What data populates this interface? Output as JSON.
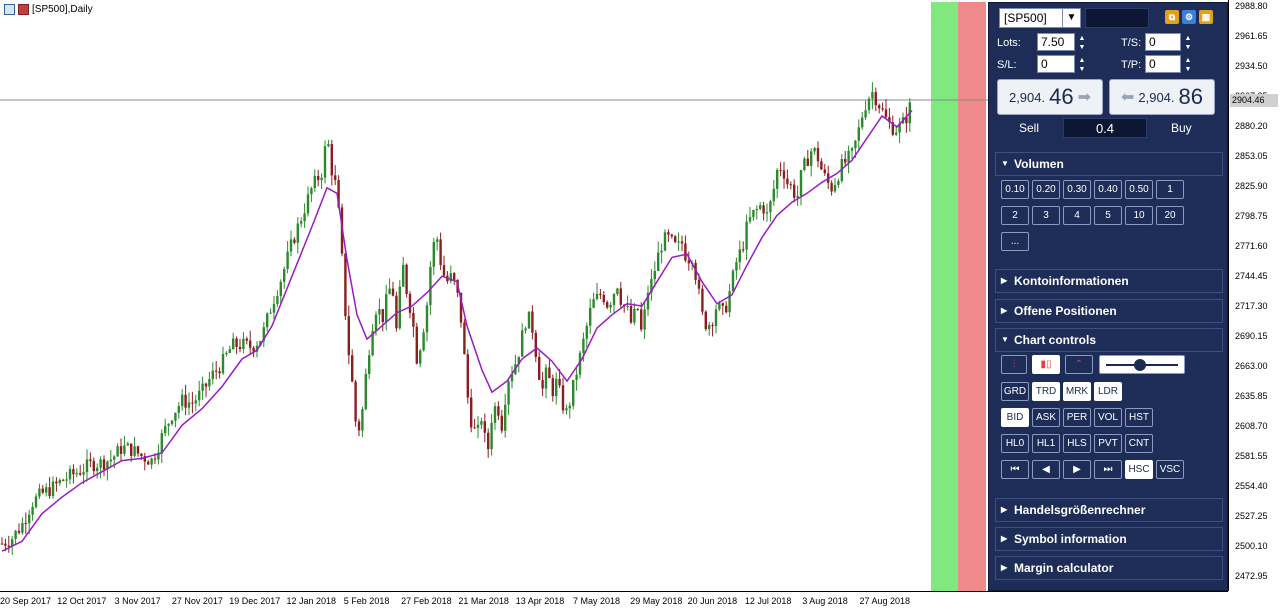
{
  "window": {
    "title": "[SP500],Daily"
  },
  "chart_data": {
    "type": "candlestick",
    "symbol": "[SP500]",
    "timeframe": "Daily",
    "ylim": [
      2460,
      2995
    ],
    "current_price": "2904.46",
    "price_ticks": [
      "2988.80",
      "2961.65",
      "2934.50",
      "2907.35",
      "2880.20",
      "2853.05",
      "2825.90",
      "2798.75",
      "2771.60",
      "2744.45",
      "2717.30",
      "2690.15",
      "2663.00",
      "2635.85",
      "2608.70",
      "2581.55",
      "2554.40",
      "2527.25",
      "2500.10",
      "2472.95"
    ],
    "time_ticks": [
      "20 Sep 2017",
      "12 Oct 2017",
      "3 Nov 2017",
      "27 Nov 2017",
      "19 Dec 2017",
      "12 Jan 2018",
      "5 Feb 2018",
      "27 Feb 2018",
      "21 Mar 2018",
      "13 Apr 2018",
      "7 May 2018",
      "29 May 2018",
      "20 Jun 2018",
      "12 Jul 2018",
      "3 Aug 2018",
      "27 Aug 2018"
    ],
    "close_path": [
      [
        0,
        2503
      ],
      [
        10,
        2508
      ],
      [
        20,
        2520
      ],
      [
        30,
        2540
      ],
      [
        40,
        2548
      ],
      [
        50,
        2553
      ],
      [
        60,
        2560
      ],
      [
        70,
        2565
      ],
      [
        80,
        2570
      ],
      [
        90,
        2575
      ],
      [
        100,
        2576
      ],
      [
        110,
        2580
      ],
      [
        120,
        2590
      ],
      [
        130,
        2588
      ],
      [
        140,
        2582
      ],
      [
        150,
        2578
      ],
      [
        160,
        2600
      ],
      [
        170,
        2620
      ],
      [
        180,
        2632
      ],
      [
        190,
        2630
      ],
      [
        200,
        2640
      ],
      [
        210,
        2655
      ],
      [
        220,
        2666
      ],
      [
        230,
        2682
      ],
      [
        240,
        2683
      ],
      [
        250,
        2681
      ],
      [
        260,
        2690
      ],
      [
        270,
        2720
      ],
      [
        280,
        2745
      ],
      [
        290,
        2775
      ],
      [
        300,
        2800
      ],
      [
        310,
        2825
      ],
      [
        320,
        2840
      ],
      [
        325,
        2872
      ],
      [
        330,
        2840
      ],
      [
        335,
        2822
      ],
      [
        340,
        2760
      ],
      [
        345,
        2690
      ],
      [
        350,
        2650
      ],
      [
        355,
        2600
      ],
      [
        360,
        2620
      ],
      [
        365,
        2665
      ],
      [
        370,
        2700
      ],
      [
        375,
        2720
      ],
      [
        380,
        2705
      ],
      [
        385,
        2725
      ],
      [
        390,
        2740
      ],
      [
        395,
        2690
      ],
      [
        400,
        2760
      ],
      [
        405,
        2730
      ],
      [
        410,
        2710
      ],
      [
        415,
        2670
      ],
      [
        420,
        2690
      ],
      [
        425,
        2720
      ],
      [
        430,
        2770
      ],
      [
        435,
        2780
      ],
      [
        440,
        2750
      ],
      [
        445,
        2740
      ],
      [
        450,
        2745
      ],
      [
        455,
        2730
      ],
      [
        460,
        2700
      ],
      [
        465,
        2640
      ],
      [
        470,
        2610
      ],
      [
        475,
        2600
      ],
      [
        480,
        2620
      ],
      [
        485,
        2580
      ],
      [
        490,
        2620
      ],
      [
        495,
        2630
      ],
      [
        500,
        2610
      ],
      [
        505,
        2650
      ],
      [
        510,
        2660
      ],
      [
        515,
        2670
      ],
      [
        520,
        2690
      ],
      [
        525,
        2710
      ],
      [
        530,
        2700
      ],
      [
        535,
        2670
      ],
      [
        540,
        2640
      ],
      [
        545,
        2660
      ],
      [
        550,
        2640
      ],
      [
        555,
        2650
      ],
      [
        560,
        2630
      ],
      [
        565,
        2620
      ],
      [
        570,
        2640
      ],
      [
        575,
        2660
      ],
      [
        580,
        2680
      ],
      [
        585,
        2700
      ],
      [
        590,
        2720
      ],
      [
        595,
        2725
      ],
      [
        600,
        2730
      ],
      [
        605,
        2720
      ],
      [
        610,
        2725
      ],
      [
        615,
        2740
      ],
      [
        620,
        2720
      ],
      [
        625,
        2715
      ],
      [
        630,
        2700
      ],
      [
        635,
        2720
      ],
      [
        640,
        2690
      ],
      [
        645,
        2730
      ],
      [
        650,
        2740
      ],
      [
        655,
        2760
      ],
      [
        660,
        2775
      ],
      [
        665,
        2780
      ],
      [
        670,
        2775
      ],
      [
        675,
        2770
      ],
      [
        680,
        2775
      ],
      [
        685,
        2760
      ],
      [
        690,
        2765
      ],
      [
        695,
        2740
      ],
      [
        700,
        2710
      ],
      [
        705,
        2700
      ],
      [
        710,
        2705
      ],
      [
        715,
        2720
      ],
      [
        720,
        2710
      ],
      [
        725,
        2720
      ],
      [
        730,
        2740
      ],
      [
        735,
        2760
      ],
      [
        740,
        2770
      ],
      [
        745,
        2790
      ],
      [
        750,
        2800
      ],
      [
        755,
        2805
      ],
      [
        760,
        2810
      ],
      [
        765,
        2800
      ],
      [
        770,
        2815
      ],
      [
        775,
        2840
      ],
      [
        780,
        2845
      ],
      [
        785,
        2830
      ],
      [
        790,
        2825
      ],
      [
        795,
        2815
      ],
      [
        800,
        2840
      ],
      [
        805,
        2850
      ],
      [
        810,
        2860
      ],
      [
        815,
        2855
      ],
      [
        820,
        2840
      ],
      [
        825,
        2830
      ],
      [
        830,
        2825
      ],
      [
        835,
        2835
      ],
      [
        840,
        2845
      ],
      [
        845,
        2850
      ],
      [
        850,
        2855
      ],
      [
        855,
        2870
      ],
      [
        860,
        2890
      ],
      [
        865,
        2905
      ],
      [
        870,
        2912
      ],
      [
        875,
        2905
      ],
      [
        880,
        2895
      ],
      [
        885,
        2885
      ],
      [
        890,
        2880
      ],
      [
        895,
        2878
      ],
      [
        900,
        2882
      ],
      [
        905,
        2890
      ],
      [
        910,
        2904
      ]
    ],
    "ma_path": [
      [
        0,
        2496
      ],
      [
        20,
        2505
      ],
      [
        40,
        2530
      ],
      [
        60,
        2545
      ],
      [
        80,
        2558
      ],
      [
        100,
        2568
      ],
      [
        120,
        2578
      ],
      [
        140,
        2580
      ],
      [
        160,
        2585
      ],
      [
        180,
        2610
      ],
      [
        200,
        2625
      ],
      [
        220,
        2645
      ],
      [
        240,
        2670
      ],
      [
        255,
        2678
      ],
      [
        270,
        2700
      ],
      [
        290,
        2745
      ],
      [
        310,
        2790
      ],
      [
        325,
        2825
      ],
      [
        335,
        2820
      ],
      [
        345,
        2760
      ],
      [
        355,
        2710
      ],
      [
        365,
        2688
      ],
      [
        380,
        2700
      ],
      [
        395,
        2712
      ],
      [
        410,
        2718
      ],
      [
        425,
        2730
      ],
      [
        440,
        2745
      ],
      [
        455,
        2740
      ],
      [
        465,
        2700
      ],
      [
        480,
        2660
      ],
      [
        490,
        2640
      ],
      [
        505,
        2650
      ],
      [
        520,
        2670
      ],
      [
        535,
        2680
      ],
      [
        550,
        2668
      ],
      [
        565,
        2650
      ],
      [
        580,
        2670
      ],
      [
        595,
        2698
      ],
      [
        610,
        2710
      ],
      [
        625,
        2720
      ],
      [
        640,
        2718
      ],
      [
        655,
        2740
      ],
      [
        670,
        2762
      ],
      [
        685,
        2765
      ],
      [
        700,
        2740
      ],
      [
        715,
        2720
      ],
      [
        730,
        2728
      ],
      [
        745,
        2755
      ],
      [
        760,
        2780
      ],
      [
        775,
        2800
      ],
      [
        790,
        2812
      ],
      [
        805,
        2820
      ],
      [
        820,
        2830
      ],
      [
        835,
        2838
      ],
      [
        850,
        2850
      ],
      [
        865,
        2870
      ],
      [
        880,
        2890
      ],
      [
        895,
        2880
      ],
      [
        910,
        2895
      ]
    ],
    "overlay_bands": [
      {
        "color": "#7fe87f"
      },
      {
        "color": "#f08a8a"
      }
    ]
  },
  "panel": {
    "symbol": "[SP500]",
    "lots_label": "Lots:",
    "lots_value": "7.50",
    "ts_label": "T/S:",
    "ts_value": "0",
    "sl_label": "S/L:",
    "sl_value": "0",
    "tp_label": "T/P:",
    "tp_value": "0",
    "sell_price_small": "2,904.",
    "sell_price_big": "46",
    "buy_price_small": "2,904.",
    "buy_price_big": "86",
    "sell_label": "Sell",
    "buy_label": "Buy",
    "spread": "0.4",
    "sections": {
      "volumen": "Volumen",
      "konto": "Kontoinformationen",
      "positionen": "Offene Positionen",
      "chart_controls": "Chart controls",
      "rechner": "Handelsgrößenrechner",
      "symbol_info": "Symbol information",
      "margin": "Margin calculator"
    },
    "volume_buttons": [
      "0.10",
      "0.20",
      "0.30",
      "0.40",
      "0.50",
      "1",
      "2",
      "3",
      "4",
      "5",
      "10",
      "20",
      "..."
    ],
    "controls_row1": [
      "GRD",
      "TRD",
      "MRK",
      "LDR"
    ],
    "controls_row2": [
      "BID",
      "ASK",
      "PER",
      "VOL",
      "HST"
    ],
    "controls_row3": [
      "HL0",
      "HL1",
      "HLS",
      "PVT",
      "CNT"
    ],
    "controls_row4": [
      "⏮",
      "◀",
      "▶",
      "⏭",
      "HSC",
      "VSC"
    ],
    "slider_level": 0.45,
    "colors": {
      "panel_bg": "#1e2d57",
      "bull": "#2c8a2c",
      "bear": "#8a1f1f",
      "ma": "#9a1cc0"
    }
  }
}
